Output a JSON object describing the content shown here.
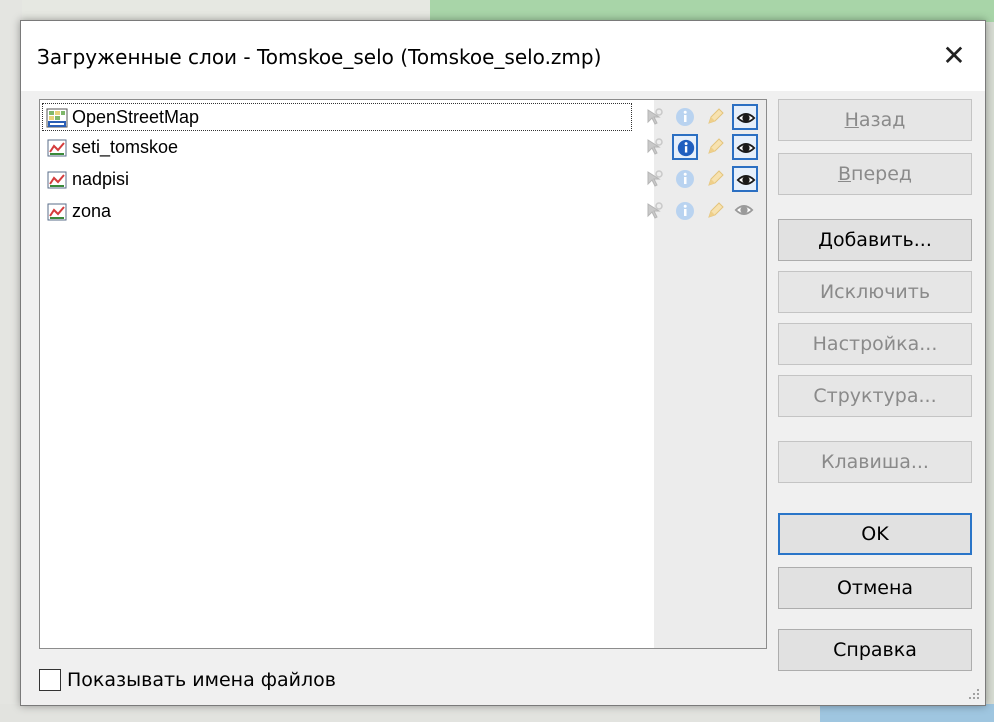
{
  "dialog": {
    "title": "Загруженные слои - Tomskoe_selo (Tomskoe_selo.zmp)",
    "close_glyph": "✕"
  },
  "layers": [
    {
      "name": "OpenStreetMap",
      "icon": "raster-layer-icon",
      "info_active": false,
      "visible_active": true,
      "selected": true
    },
    {
      "name": "seti_tomskoe",
      "icon": "vector-layer-icon",
      "info_active": true,
      "visible_active": true,
      "selected": false
    },
    {
      "name": "nadpisi",
      "icon": "vector-layer-icon",
      "info_active": false,
      "visible_active": true,
      "selected": false
    },
    {
      "name": "zona",
      "icon": "vector-layer-icon",
      "info_active": false,
      "visible_active": false,
      "selected": false
    }
  ],
  "buttons": {
    "back": {
      "mnemonic": "Н",
      "rest": "азад"
    },
    "forward": {
      "mnemonic": "В",
      "rest": "перед"
    },
    "add": "Добавить...",
    "exclude": "Исключить",
    "settings": "Настройка...",
    "structure": "Структура...",
    "hotkey": "Клавиша...",
    "ok": "OK",
    "cancel": "Отмена",
    "help": "Справка"
  },
  "show_file_names": {
    "label": "Показывать имена файлов",
    "checked": false
  },
  "colors": {
    "accent": "#2b6fc2",
    "info_blue": "#1f5fbf",
    "eye_active": "#1a1a1a"
  }
}
